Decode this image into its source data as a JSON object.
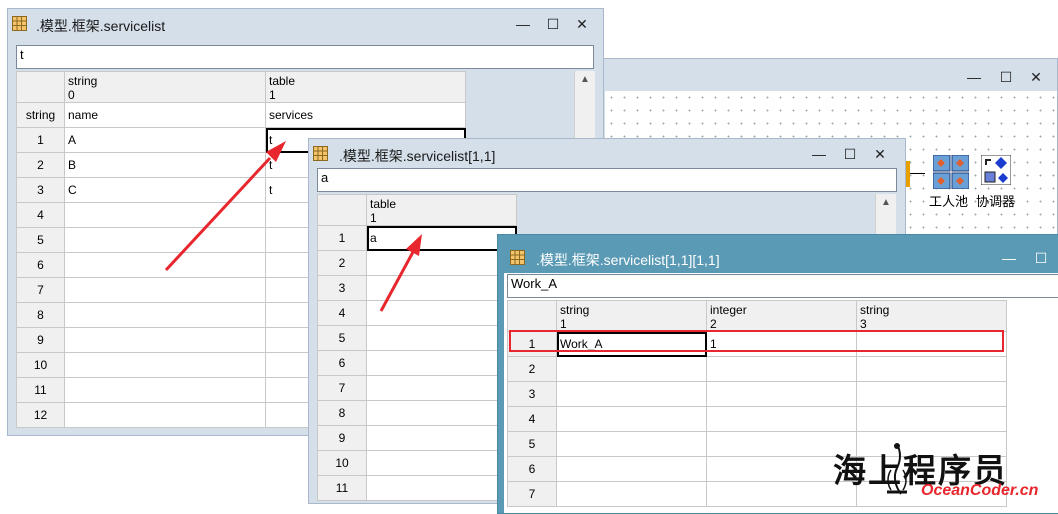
{
  "window1": {
    "title": ".模型.框架.servicelist",
    "input": "t",
    "columns": [
      {
        "type": "string",
        "index": "0",
        "name": "name"
      },
      {
        "type": "table",
        "index": "1",
        "name": "services"
      }
    ],
    "header_row_label": "string",
    "rows": [
      {
        "n": "1",
        "cells": [
          "A",
          "t"
        ]
      },
      {
        "n": "2",
        "cells": [
          "B",
          "t"
        ]
      },
      {
        "n": "3",
        "cells": [
          "C",
          "t"
        ]
      },
      {
        "n": "4",
        "cells": [
          "",
          ""
        ]
      },
      {
        "n": "5",
        "cells": [
          "",
          ""
        ]
      },
      {
        "n": "6",
        "cells": [
          "",
          ""
        ]
      },
      {
        "n": "7",
        "cells": [
          "",
          ""
        ]
      },
      {
        "n": "8",
        "cells": [
          "",
          ""
        ]
      },
      {
        "n": "9",
        "cells": [
          "",
          ""
        ]
      },
      {
        "n": "10",
        "cells": [
          "",
          ""
        ]
      },
      {
        "n": "11",
        "cells": [
          "",
          ""
        ]
      },
      {
        "n": "12",
        "cells": [
          "",
          ""
        ]
      }
    ]
  },
  "window_model": {
    "node1_label": "工人池",
    "node2_label": "协调器"
  },
  "window2": {
    "title": ".模型.框架.servicelist[1,1]",
    "input": "a",
    "columns": [
      {
        "type": "table",
        "index": "1"
      }
    ],
    "rows": [
      {
        "n": "1",
        "cells": [
          "a"
        ]
      },
      {
        "n": "2",
        "cells": [
          ""
        ]
      },
      {
        "n": "3",
        "cells": [
          ""
        ]
      },
      {
        "n": "4",
        "cells": [
          ""
        ]
      },
      {
        "n": "5",
        "cells": [
          ""
        ]
      },
      {
        "n": "6",
        "cells": [
          ""
        ]
      },
      {
        "n": "7",
        "cells": [
          ""
        ]
      },
      {
        "n": "8",
        "cells": [
          ""
        ]
      },
      {
        "n": "9",
        "cells": [
          ""
        ]
      },
      {
        "n": "10",
        "cells": [
          ""
        ]
      },
      {
        "n": "11",
        "cells": [
          ""
        ]
      }
    ]
  },
  "window3": {
    "title": ".模型.框架.servicelist[1,1][1,1]",
    "input": "Work_A",
    "columns": [
      {
        "type": "string",
        "index": "1"
      },
      {
        "type": "integer",
        "index": "2"
      },
      {
        "type": "string",
        "index": "3"
      }
    ],
    "rows": [
      {
        "n": "1",
        "cells": [
          "Work_A",
          "1",
          ""
        ]
      },
      {
        "n": "2",
        "cells": [
          "",
          "",
          ""
        ]
      },
      {
        "n": "3",
        "cells": [
          "",
          "",
          ""
        ]
      },
      {
        "n": "4",
        "cells": [
          "",
          "",
          ""
        ]
      },
      {
        "n": "5",
        "cells": [
          "",
          "",
          ""
        ]
      },
      {
        "n": "6",
        "cells": [
          "",
          "",
          ""
        ]
      },
      {
        "n": "7",
        "cells": [
          "",
          "",
          ""
        ]
      }
    ]
  },
  "watermark": {
    "cn": "海上程序员",
    "en": "OceanCoder.cn"
  },
  "colors": {
    "active_titlebar": "#5a9ab5",
    "inactive_titlebar": "#d5dfe9",
    "highlight": "#e8262d",
    "arrow": "#e8262d"
  },
  "controls": {
    "minimize": "—",
    "maximize": "☐",
    "close": "✕"
  }
}
